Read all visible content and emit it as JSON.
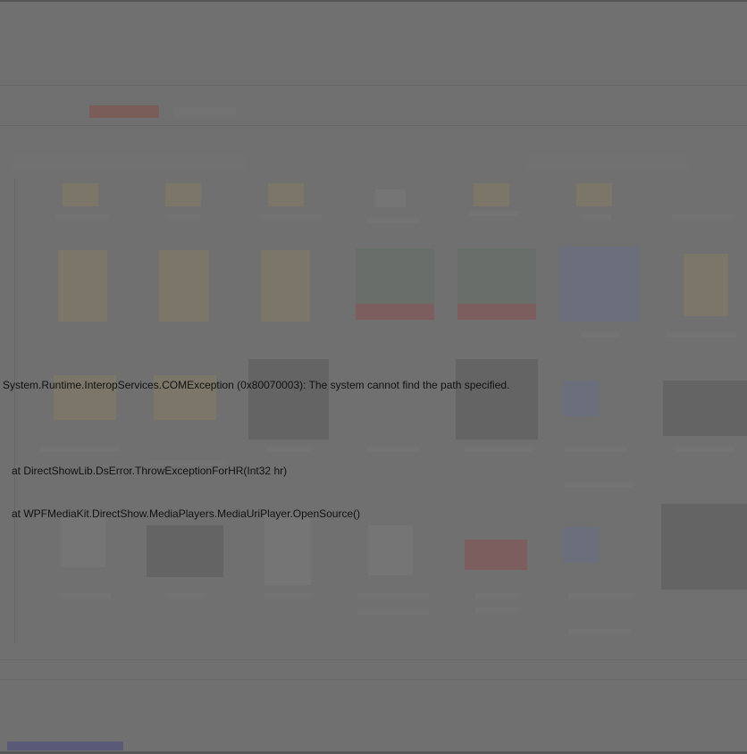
{
  "error": {
    "message": "System.Runtime.InteropServices.COMException (0x80070003): The system cannot find the path specified.",
    "stack": [
      "at DirectShowLib.DsError.ThrowExceptionForHR(Int32 hr)",
      "at WPFMediaKit.DirectShow.MediaPlayers.MediaUriPlayer.OpenSource()"
    ]
  },
  "colors": {
    "overlay_dim": "#707070",
    "text": "#111111"
  }
}
